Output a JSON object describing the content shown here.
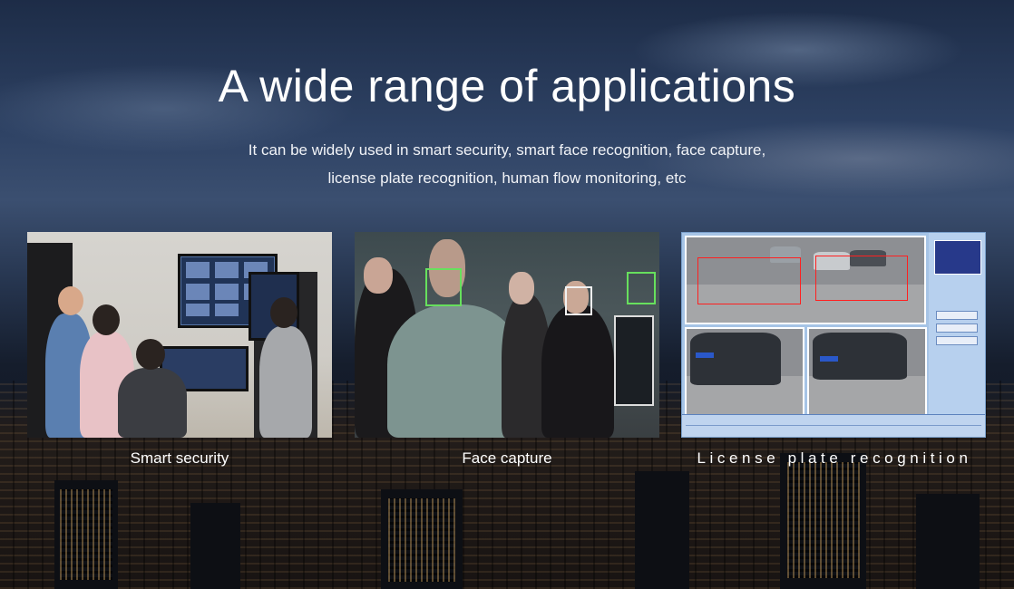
{
  "section": {
    "title": "A wide range of applications",
    "description": "It can be widely used in smart security, smart face recognition, face capture, license plate recognition, human flow monitoring, etc"
  },
  "applications": [
    {
      "caption": "Smart security"
    },
    {
      "caption": "Face capture"
    },
    {
      "caption": "License plate recognition"
    }
  ],
  "colors": {
    "sky_top": "#1d2c47",
    "sky_mid": "#3b4f70",
    "city_dark": "#0e121b",
    "face_box_green": "#67e05d",
    "plate_blue": "#2a58c9",
    "ui_panel_blue": "#a6c4e6"
  }
}
